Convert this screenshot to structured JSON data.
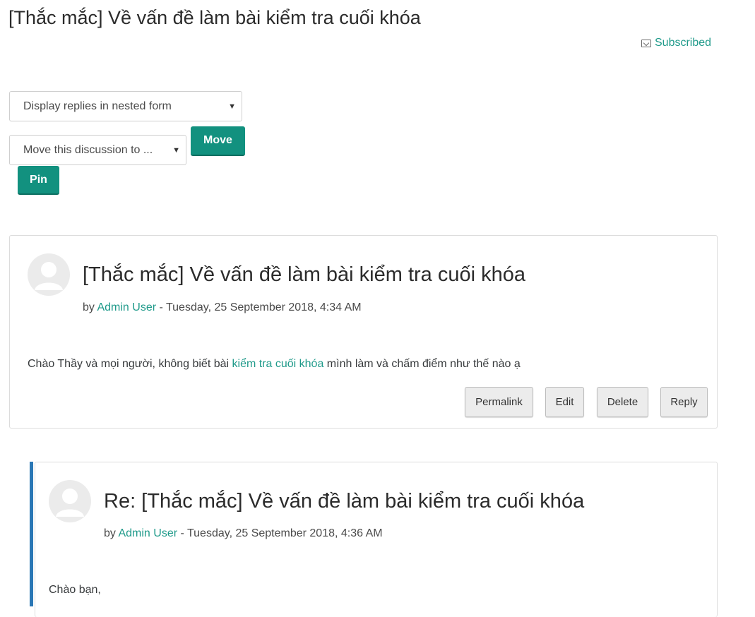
{
  "discussion": {
    "title": "[Thắc mắc] Về vấn đề làm bài kiểm tra cuối khóa",
    "subscribe_label": "Subscribed"
  },
  "controls": {
    "display_mode": "Display replies in nested form",
    "move_target": "Move this discussion to ...",
    "move_label": "Move",
    "pin_label": "Pin"
  },
  "posts": [
    {
      "subject": "[Thắc mắc] Về vấn đề làm bài kiểm tra cuối khóa",
      "by": "by",
      "author": "Admin User",
      "date": " - Tuesday, 25 September 2018, 4:34 AM",
      "body_before": "Chào Thầy và mọi người, không biết bài ",
      "body_link": "kiểm tra cuối khóa",
      "body_after": " mình làm và chấm điểm như thế nào ạ",
      "actions": {
        "permalink": "Permalink",
        "edit": "Edit",
        "delete": "Delete",
        "reply": "Reply"
      }
    },
    {
      "subject": "Re: [Thắc mắc] Về vấn đề làm bài kiểm tra cuối khóa",
      "by": "by",
      "author": "Admin User",
      "date": " - Tuesday, 25 September 2018, 4:36 AM",
      "body": "Chào bạn,"
    }
  ],
  "icons": {
    "subscribe": "envelope-icon",
    "avatar": "user-avatar-icon",
    "dropdown": "caret-down-icon"
  },
  "colors": {
    "accent": "#12917f",
    "link": "#1f9a8a",
    "reply_indicator": "#2a77b5"
  }
}
